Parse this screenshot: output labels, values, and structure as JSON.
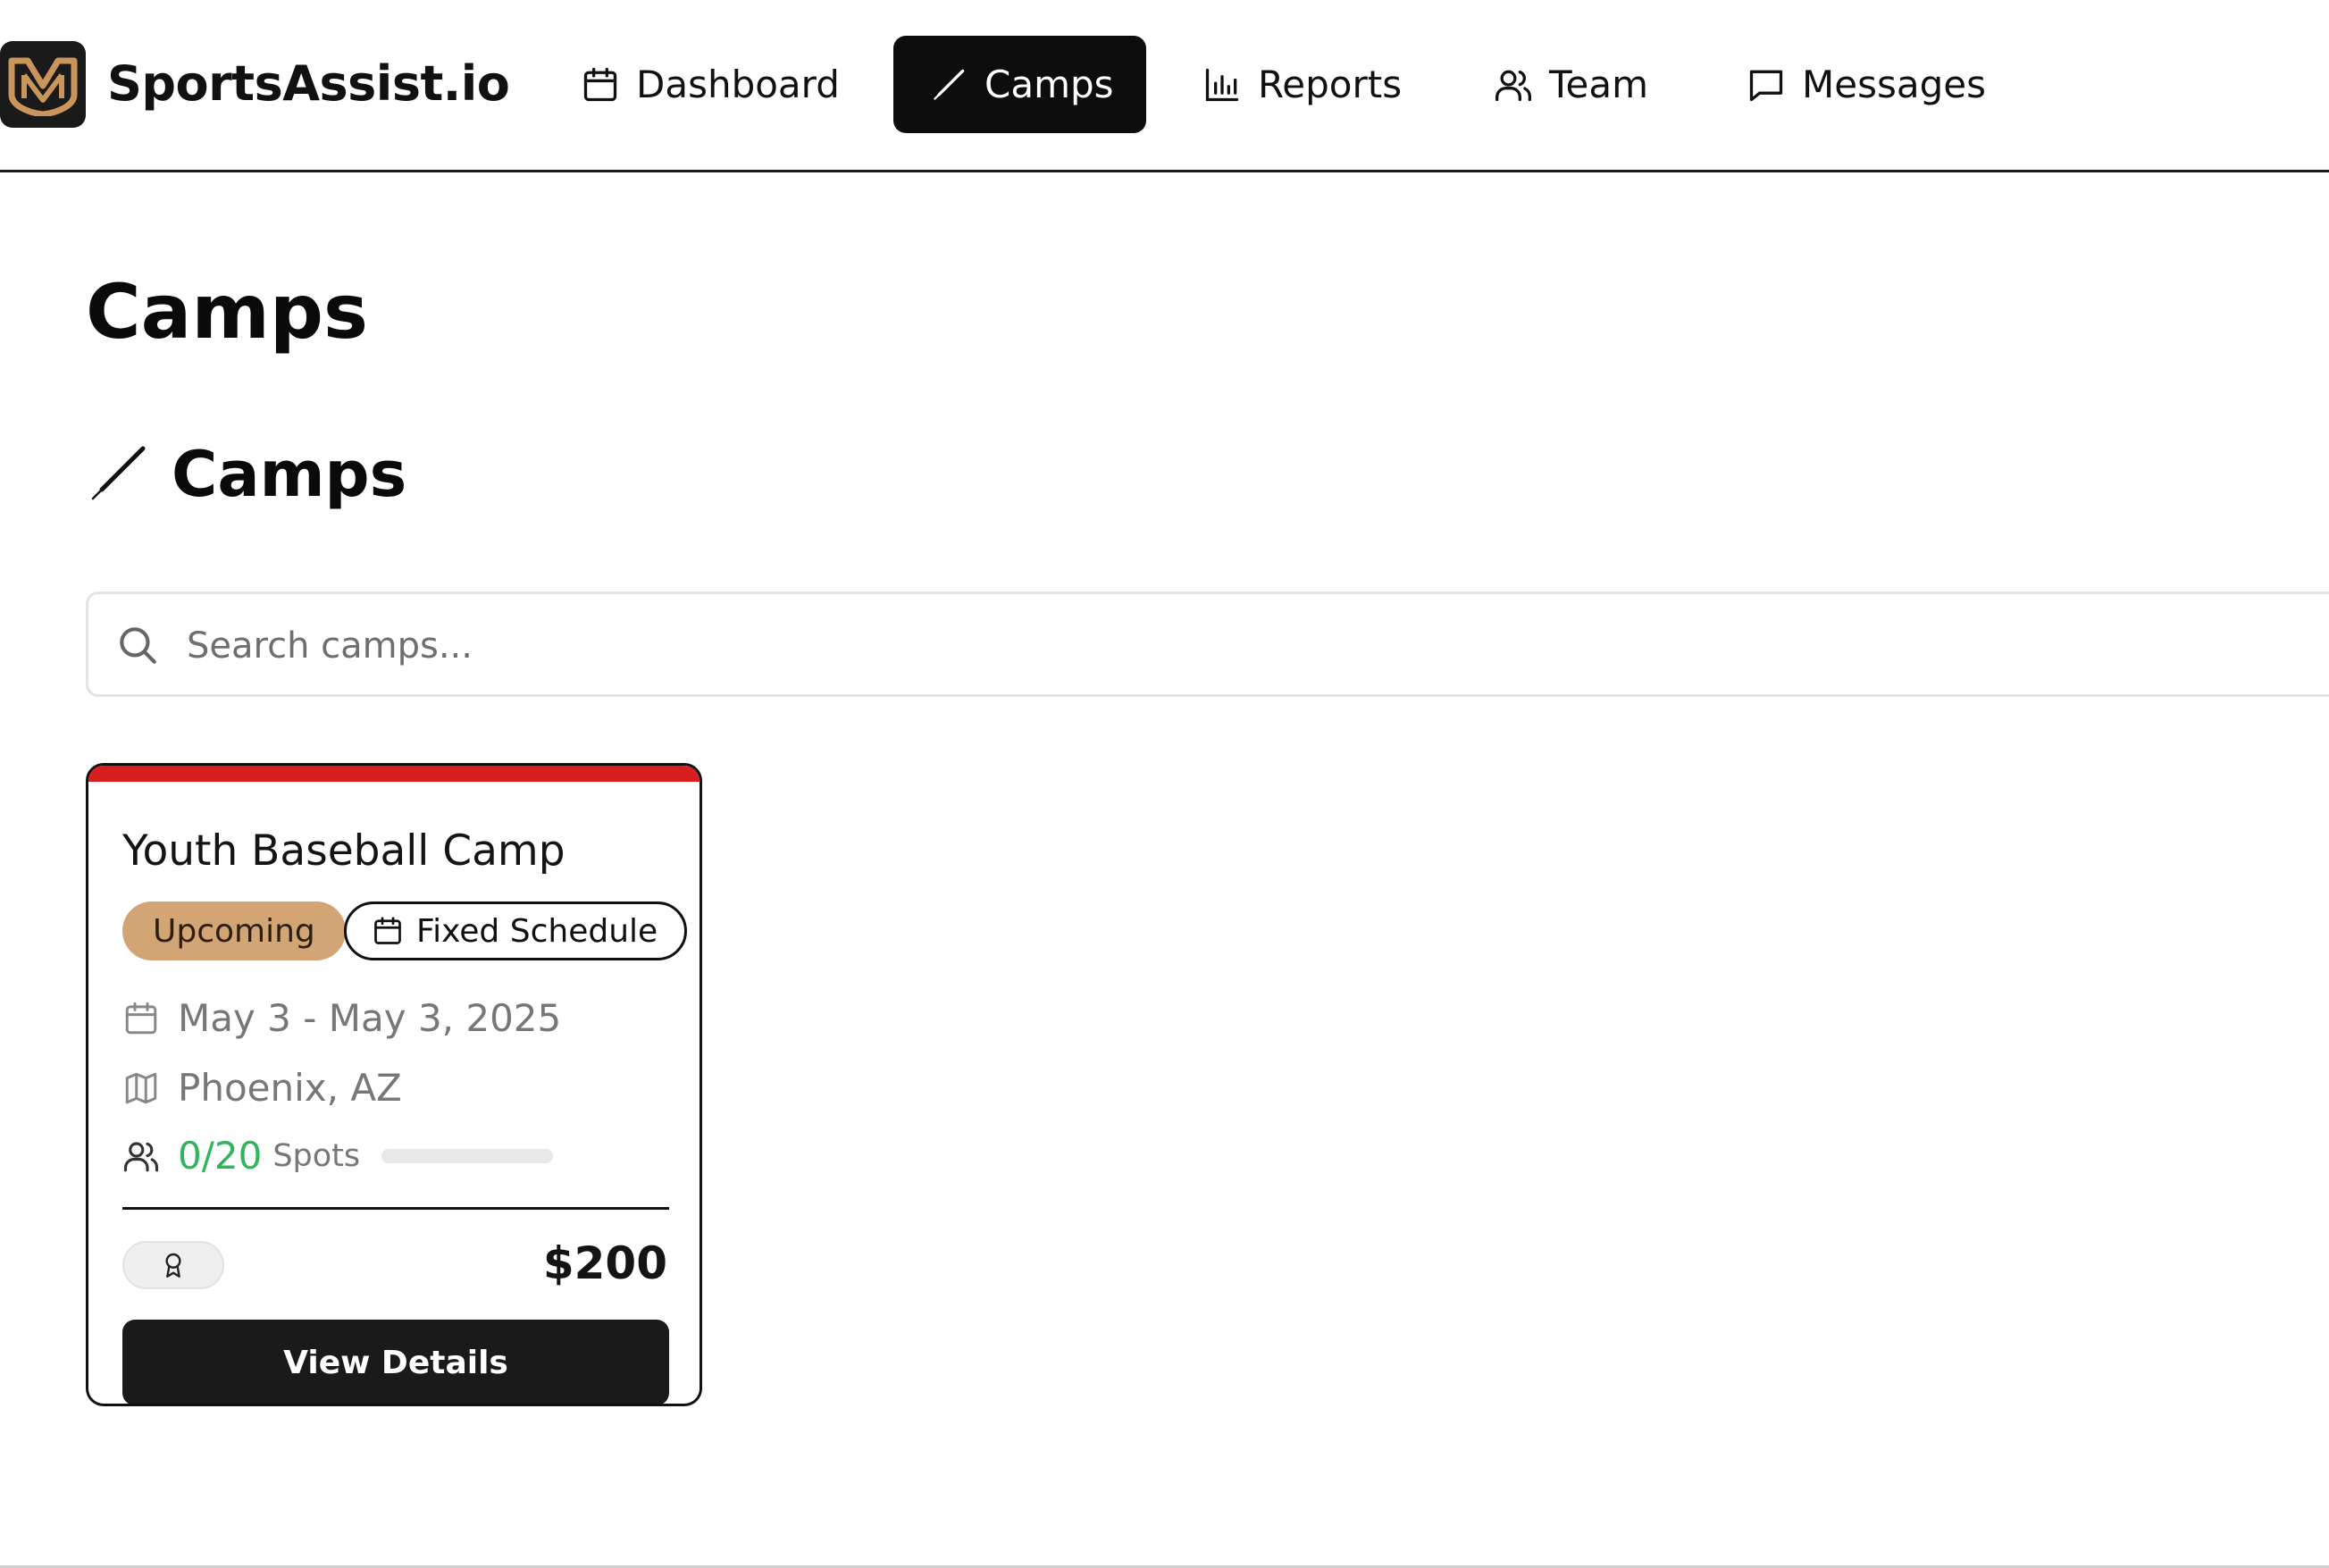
{
  "brand": {
    "name": "SportsAssist.io",
    "logo_icon": "shield-m-logo",
    "logo_colors": {
      "background": "#1a1a1a",
      "mark": "#c9955b"
    }
  },
  "nav": {
    "items": [
      {
        "label": "Dashboard",
        "icon": "calendar-icon",
        "active": false
      },
      {
        "label": "Camps",
        "icon": "bat-icon",
        "active": true
      },
      {
        "label": "Reports",
        "icon": "bar-chart-icon",
        "active": false
      },
      {
        "label": "Team",
        "icon": "users-icon",
        "active": false
      },
      {
        "label": "Messages",
        "icon": "message-square-icon",
        "active": false
      }
    ]
  },
  "page": {
    "title": "Camps"
  },
  "section": {
    "title": "Camps",
    "icon": "bat-icon"
  },
  "search": {
    "placeholder": "Search camps...",
    "value": ""
  },
  "camps": [
    {
      "title": "Youth Baseball Camp",
      "accent_color": "#d71f1f",
      "status": "Upcoming",
      "status_color": "#d4a574",
      "schedule_type": "Fixed Schedule",
      "dates": "May 3 - May 3, 2025",
      "location": "Phoenix, AZ",
      "spots_filled": "0/20",
      "spots_label": "Spots",
      "spots_fraction": 0,
      "spots_color": "#2fb55a",
      "price": "$200",
      "award_icon": "award-icon",
      "action_label": "View Details"
    }
  ]
}
